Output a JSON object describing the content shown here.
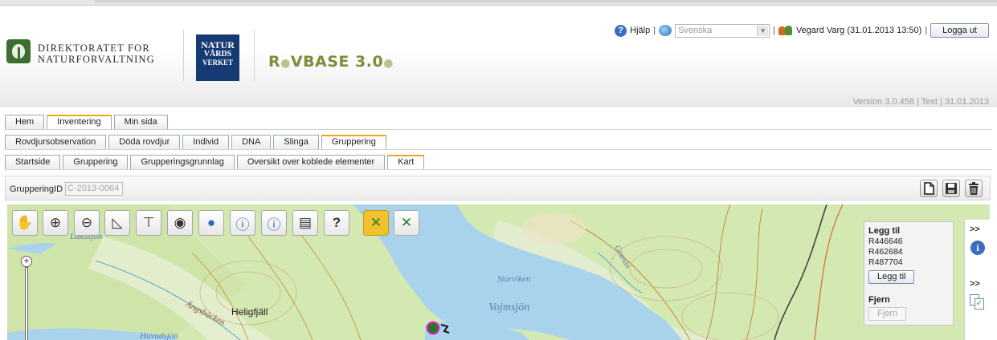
{
  "header": {
    "org1_line1": "DIREKTORATET FOR",
    "org1_line2": "NATURFORVALTNING",
    "org2_line1": "NATUR",
    "org2_line2": "VÅRDS",
    "org2_line3": "VERKET",
    "app_name_r": "R",
    "app_name_rest": "VBASE 3.0",
    "help_label": "Hjälp",
    "language_value": "Svenska",
    "user_info": "Vegard Varg (31.01.2013 13:50)",
    "logout_label": "Logga ut",
    "separator": "|",
    "version_text": "Version 3.0.458 | Test | 31.01.2013",
    "colors": {
      "brand_green": "#7b8e3a",
      "nv_blue": "#163a72",
      "tab_accent": "#e8a623"
    }
  },
  "nav": {
    "main_tabs": [
      {
        "label": "Hem",
        "active": false
      },
      {
        "label": "Inventering",
        "active": true
      },
      {
        "label": "Min sida",
        "active": false
      }
    ],
    "sub_tabs": [
      {
        "label": "Rovdjursobservation",
        "active": false
      },
      {
        "label": "Döda rovdjur",
        "active": false
      },
      {
        "label": "Individ",
        "active": false
      },
      {
        "label": "DNA",
        "active": false
      },
      {
        "label": "Slinga",
        "active": false
      },
      {
        "label": "Gruppering",
        "active": true
      }
    ],
    "sub_sub_tabs": [
      {
        "label": "Startside",
        "active": false
      },
      {
        "label": "Gruppering",
        "active": false
      },
      {
        "label": "Grupperingsgrunnlag",
        "active": false
      },
      {
        "label": "Oversikt over koblede elementer",
        "active": false
      },
      {
        "label": "Kart",
        "active": true
      }
    ]
  },
  "idbar": {
    "label": "GrupperingID",
    "value": "C-2013-0064",
    "actions": [
      "new-document-icon",
      "save-icon",
      "delete-icon"
    ]
  },
  "map": {
    "tools": [
      {
        "icon": "pan-hand-icon",
        "glyph": "✋",
        "active": false
      },
      {
        "icon": "zoom-in-icon",
        "glyph": "⊕",
        "active": false
      },
      {
        "icon": "zoom-out-icon",
        "glyph": "⊖",
        "active": false
      },
      {
        "icon": "measure-area-icon",
        "glyph": "◺",
        "active": false
      },
      {
        "icon": "measure-line-icon",
        "glyph": "⊤",
        "active": false
      },
      {
        "icon": "select-circle-icon",
        "glyph": "◉",
        "active": false
      },
      {
        "icon": "globe-icon",
        "glyph": "●",
        "active": false
      },
      {
        "icon": "info-icon",
        "glyph": "ⓘ",
        "active": false
      },
      {
        "icon": "info-area-icon",
        "glyph": "ⓘ",
        "active": false
      },
      {
        "icon": "print-icon",
        "glyph": "▤",
        "active": false
      },
      {
        "icon": "help-icon",
        "glyph": "?",
        "active": false
      },
      {
        "icon": "link-network-active-icon",
        "glyph": "✕",
        "active": true
      },
      {
        "icon": "link-network-icon",
        "glyph": "✕",
        "active": false
      }
    ],
    "labels": {
      "lakes1": "Lakasjön",
      "heligfjall": "Heligfjäll",
      "angsbacken": "Ängsbäcken",
      "huvudsjon": "Huvudsjön",
      "storviken": "Storviken",
      "vojmsjon": "Vojmsjön",
      "granan": "Granån"
    },
    "side_panel": {
      "add_title": "Legg til",
      "records": [
        "R446646",
        "R462684",
        "R487704"
      ],
      "add_button": "Legg til",
      "remove_title": "Fjern",
      "remove_button": "Fjern"
    },
    "side_tabs": {
      "expand1": ">>",
      "expand2": ">>",
      "icons": [
        "info-icon",
        "copy-check-icon"
      ]
    }
  }
}
